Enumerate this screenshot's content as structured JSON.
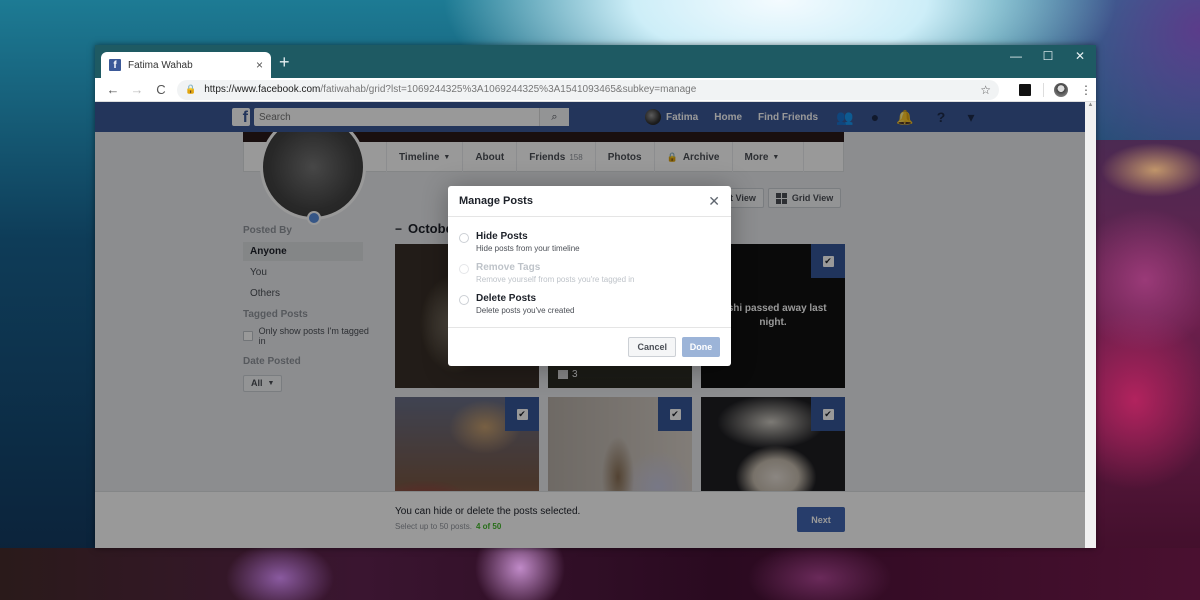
{
  "browser": {
    "tab_title": "Fatima Wahab",
    "tab_close": "×",
    "new_tab": "+",
    "window_controls": {
      "minimize": "—",
      "maximize": "☐",
      "close": "✕"
    },
    "nav": {
      "back": "←",
      "forward": "→",
      "reload": "C"
    },
    "url_host": "https://www.facebook.com",
    "url_path": "/fatiwahab/grid?lst=1069244325%3A1069244325%3A1541093465&subkey=manage",
    "star": "☆",
    "menu": "⋮"
  },
  "fb_header": {
    "logo": "f",
    "search_placeholder": "Search",
    "search_icon": "⌕",
    "user_name": "Fatima",
    "links": [
      "Home",
      "Find Friends"
    ],
    "icons": {
      "friends": "👥",
      "messenger": "●",
      "notifications": "🔔",
      "help": "?",
      "dropdown": "▾"
    }
  },
  "profile_nav": {
    "items": [
      {
        "label": "Timeline",
        "caret": "▼"
      },
      {
        "label": "About"
      },
      {
        "label": "Friends",
        "count": "158"
      },
      {
        "label": "Photos"
      },
      {
        "label": "Archive",
        "lock": "🔒"
      },
      {
        "label": "More",
        "caret": "▼"
      }
    ]
  },
  "view_buttons": {
    "list": "List View",
    "grid": "Grid View"
  },
  "filters": {
    "posted_by_heading": "Posted By",
    "posted_by_options": [
      "Anyone",
      "You",
      "Others"
    ],
    "posted_by_selected": "Anyone",
    "tagged_heading": "Tagged Posts",
    "tagged_checkbox_label": "Only show posts I'm tagged in",
    "tagged_checked": false,
    "date_heading": "Date Posted",
    "date_value": "All",
    "date_caret": "▼"
  },
  "month_heading": {
    "collapse": "−",
    "label": "October"
  },
  "posts": [
    {
      "type": "photo",
      "selected": false
    },
    {
      "type": "album",
      "selected": false,
      "album_count": "3"
    },
    {
      "type": "status",
      "selected": true,
      "text": "...shi passed away last night."
    },
    {
      "type": "photo",
      "selected": true
    },
    {
      "type": "photo",
      "selected": true
    },
    {
      "type": "photo",
      "selected": true
    }
  ],
  "check_glyph": "✔",
  "footer": {
    "main_text": "You can hide or delete the posts selected.",
    "sub_text": "Select up to 50 posts.",
    "count": "4 of 50",
    "next_label": "Next"
  },
  "dialog": {
    "title": "Manage Posts",
    "close": "✕",
    "options": [
      {
        "title": "Hide Posts",
        "desc": "Hide posts from your timeline",
        "disabled": false
      },
      {
        "title": "Remove Tags",
        "desc": "Remove yourself from posts you're tagged in",
        "disabled": true
      },
      {
        "title": "Delete Posts",
        "desc": "Delete posts you've created",
        "disabled": false
      }
    ],
    "cancel_label": "Cancel",
    "done_label": "Done"
  },
  "colors": {
    "fb_blue": "#3b5998",
    "button_blue": "#4267b2",
    "done_disabled": "#9cb4d8",
    "count_green": "#42b72a",
    "titlebar": "#1e5a63"
  }
}
